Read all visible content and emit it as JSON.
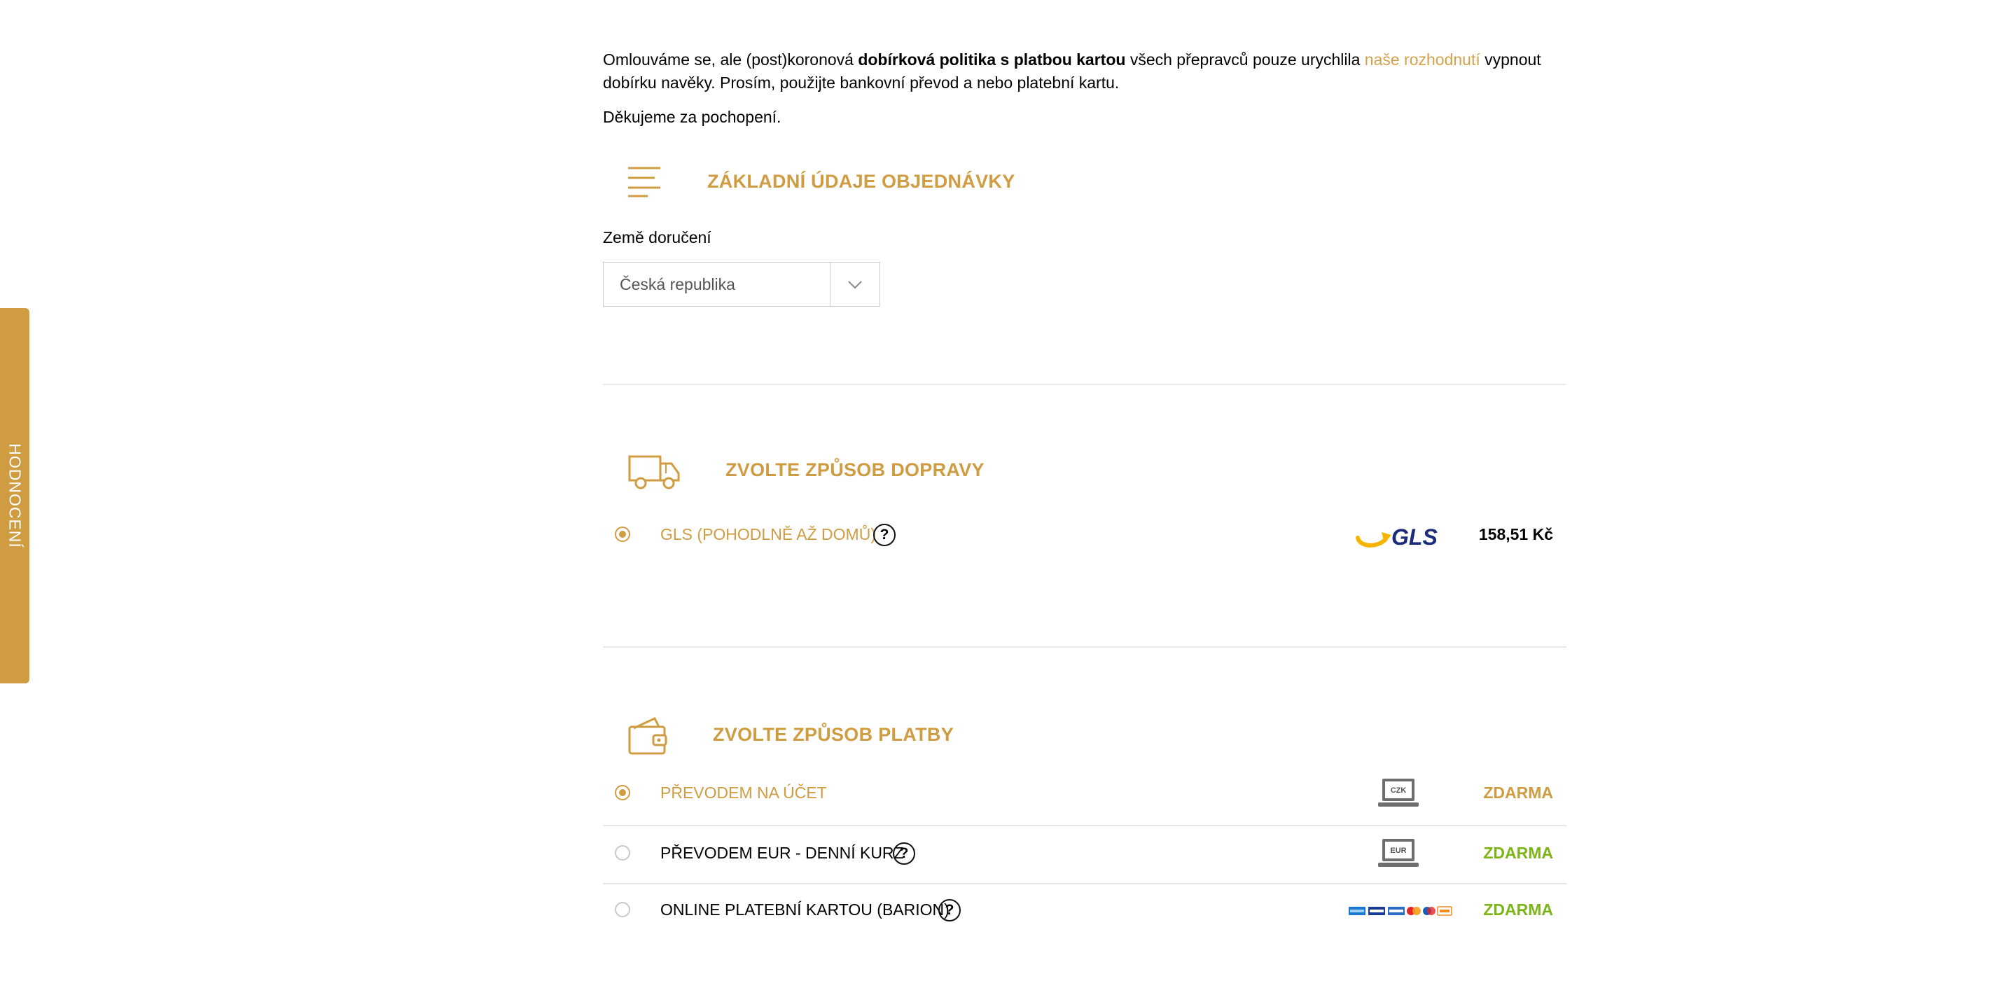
{
  "side_tab": {
    "label": "HODNOCENÍ"
  },
  "notice": {
    "part1": "Omlouváme se, ale (post)koronová ",
    "bold": "dobírková politika s platbou kartou",
    "part2": " všech přepravců pouze urychlila ",
    "link": "naše rozhodnutí",
    "part3": " vypnout dobírku navěky. Prosím, použijte bankovní převod a nebo platební kartu.",
    "thanks": "Děkujeme za pochopení."
  },
  "basic_section": {
    "title": "ZÁKLADNÍ ÚDAJE OBJEDNÁVKY",
    "icon": "list-lines-icon",
    "country_label": "Země doručení",
    "country_value": "Česká republika"
  },
  "shipping_section": {
    "title": "ZVOLTE ZPŮSOB DOPRAVY",
    "icon": "truck-icon",
    "options": [
      {
        "label": "GLS (POHODLNĚ AŽ DOMŮ)",
        "logo": "GLS",
        "price": "158,51 Kč",
        "selected": true,
        "help": "?"
      }
    ]
  },
  "payment_section": {
    "title": "ZVOLTE ZPŮSOB PLATBY",
    "icon": "wallet-icon",
    "options": [
      {
        "label": "PŘEVODEM NA ÚČET",
        "logo_text": "CZK",
        "price": "ZDARMA",
        "selected": true
      },
      {
        "label": "PŘEVODEM EUR - DENNÍ KURZ",
        "logo_text": "EUR",
        "price": "ZDARMA",
        "selected": false,
        "help": "?"
      },
      {
        "label": "ONLINE PLATEBNÍ KARTOU (BARION)",
        "logo": "card-brands",
        "price": "ZDARMA",
        "selected": false,
        "help": "?"
      }
    ]
  },
  "colors": {
    "accent": "#cf9c42",
    "free": "#7cb518",
    "gls_blue": "#1a2c7a",
    "gls_yellow": "#f5b400"
  }
}
